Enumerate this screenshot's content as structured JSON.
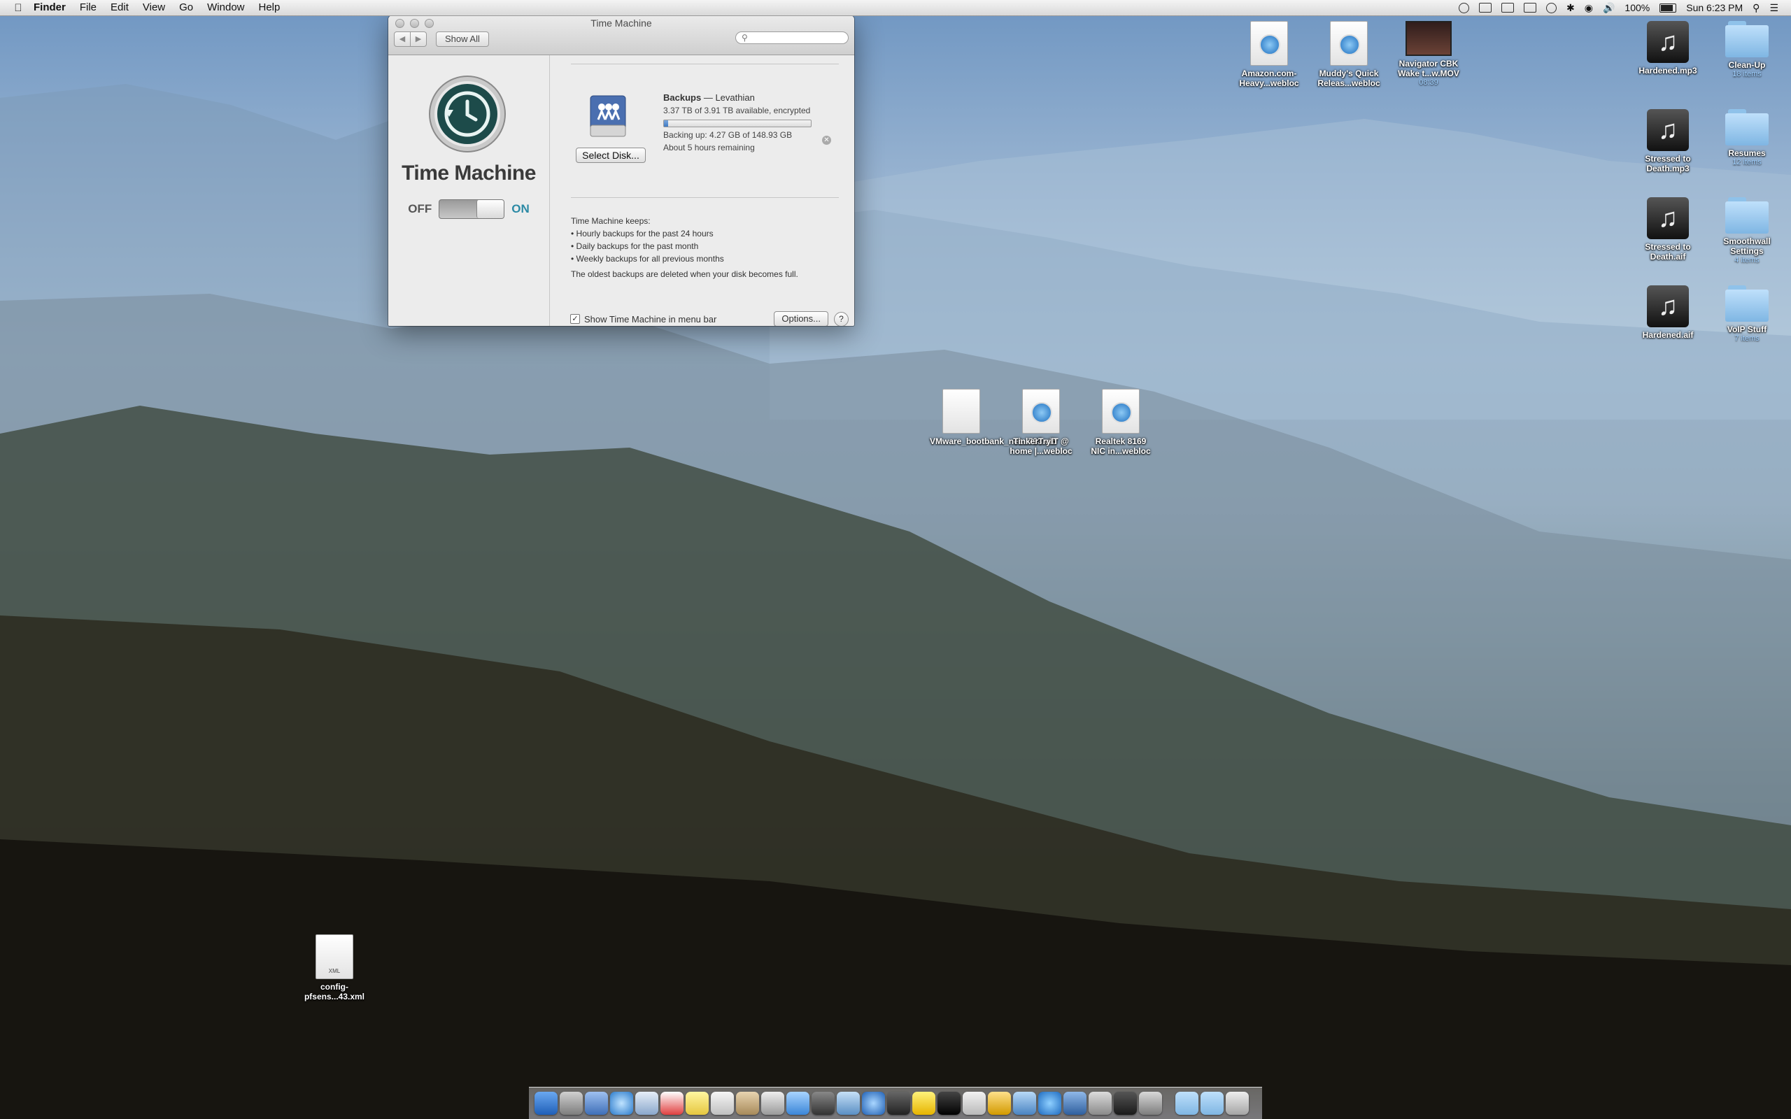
{
  "menubar": {
    "app": "Finder",
    "menus": [
      "File",
      "Edit",
      "View",
      "Go",
      "Window",
      "Help"
    ],
    "battery": "100%",
    "clock": "Sun 6:23 PM"
  },
  "window": {
    "title": "Time Machine",
    "show_all": "Show All",
    "search_placeholder": "",
    "app_name": "Time Machine",
    "toggle_off": "OFF",
    "toggle_on": "ON",
    "toggle_state": "on",
    "select_disk": "Select Disk...",
    "disk_title": "Backups",
    "disk_subtitle": "— Levathian",
    "disk_space": "3.37 TB of 3.91 TB available, encrypted",
    "backup_progress": 0.03,
    "backing_up": "Backing up: 4.27 GB of 148.93 GB",
    "remaining": "About 5 hours remaining",
    "keeps_title": "Time Machine keeps:",
    "keeps": [
      "• Hourly backups for the past 24 hours",
      "• Daily backups for the past month",
      "• Weekly backups for all previous months"
    ],
    "oldest_note": "The oldest backups are deleted when your disk becomes full.",
    "show_in_menubar": "Show Time Machine in menu bar",
    "show_in_menubar_checked": true,
    "options": "Options...",
    "help": "?"
  },
  "desktop_icons": [
    {
      "label": "Amazon.com- Heavy...webloc",
      "type": "webloc"
    },
    {
      "label": "Muddy's Quick Releas...webloc",
      "type": "webloc"
    },
    {
      "label": "Navigator CBK Wake t...w.MOV",
      "sub": "08:39",
      "type": "movie"
    },
    {
      "label": "Hardened.mp3",
      "type": "music"
    },
    {
      "label": "Clean-Up",
      "sub": "18 items",
      "type": "folder"
    },
    {
      "label": "Stressed to Death.mp3",
      "type": "music"
    },
    {
      "label": "Resumes",
      "sub": "12 items",
      "type": "folder"
    },
    {
      "label": "Stressed to Death.aif",
      "type": "music"
    },
    {
      "label": "Smoothwall Settings",
      "sub": "4 items",
      "type": "folder"
    },
    {
      "label": "Hardened.aif",
      "type": "music"
    },
    {
      "label": "VoIP Stuff",
      "sub": "7 items",
      "type": "folder"
    },
    {
      "label": "VMware_bootbank_net...733.vib",
      "type": "doc"
    },
    {
      "label": "TinkerTryIT @ home |...webloc",
      "type": "webloc"
    },
    {
      "label": "Realtek 8169 NIC in...webloc",
      "type": "webloc"
    },
    {
      "label": "config-pfsens...43.xml",
      "type": "xml",
      "badge": "XML"
    }
  ],
  "colors": {
    "accent_on": "#2c8aa5",
    "folder": "#8fc2ea",
    "progress": "#3f7bc4"
  }
}
